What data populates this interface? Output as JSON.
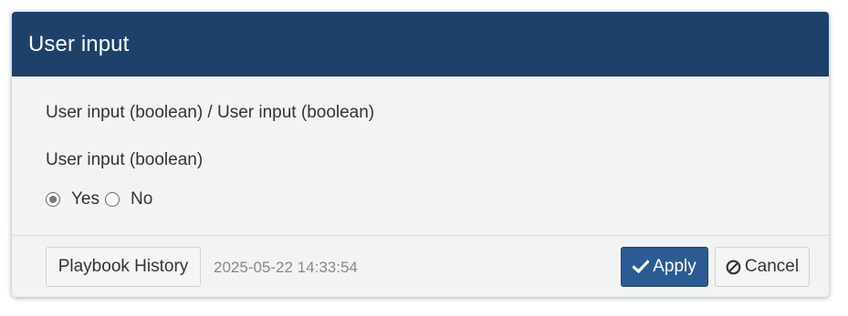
{
  "dialog": {
    "title": "User input",
    "breadcrumb": "User input (boolean) / User input (boolean)",
    "field_label": "User input (boolean)",
    "options": [
      {
        "label": "Yes",
        "checked": true
      },
      {
        "label": "No",
        "checked": false
      }
    ]
  },
  "footer": {
    "history_label": "Playbook History",
    "timestamp": "2025-05-22 14:33:54",
    "apply_label": "Apply",
    "cancel_label": "Cancel",
    "apply_icon": "check-icon",
    "cancel_icon": "ban-icon"
  },
  "colors": {
    "header_bg": "#1e416a",
    "body_bg": "#f2f4f4",
    "apply_bg": "#2b5b92"
  }
}
